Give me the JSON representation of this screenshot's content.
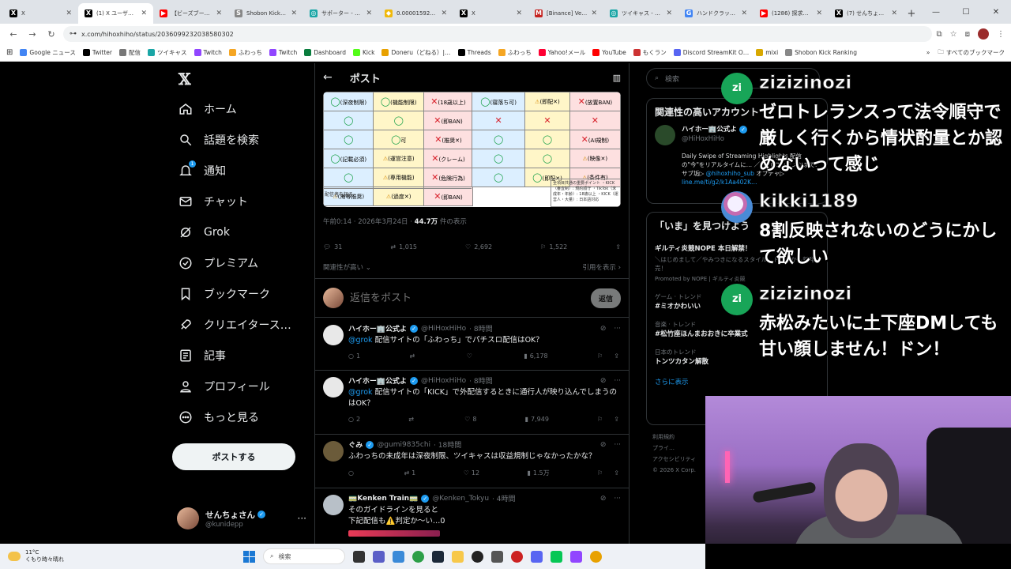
{
  "browser": {
    "tabs": [
      {
        "title": "X",
        "fav": "X",
        "color": "#000000"
      },
      {
        "title": "(1) X ユーザー: 「…",
        "fav": "X",
        "color": "#000000",
        "active": true
      },
      {
        "title": "【ビーズブーリ…",
        "fav": "▶",
        "color": "#ff0000"
      },
      {
        "title": "Shobon Kick…",
        "fav": "S",
        "color": "#888888"
      },
      {
        "title": "サポーター - せ…",
        "fav": "◎",
        "color": "#1aa6a6"
      },
      {
        "title": "0.00001592…",
        "fav": "◆",
        "color": "#f0b90b"
      },
      {
        "title": "X",
        "fav": "X",
        "color": "#000000"
      },
      {
        "title": "[Binance] Ve…",
        "fav": "M",
        "color": "#c5221f"
      },
      {
        "title": "ツイキャス - せ…",
        "fav": "◎",
        "color": "#1aa6a6"
      },
      {
        "title": "ハンドクラップ…",
        "fav": "G",
        "color": "#4285f4"
      },
      {
        "title": "(1286) 探求…",
        "fav": "▶",
        "color": "#ff0000"
      },
      {
        "title": "(7) せんちょさ…",
        "fav": "X",
        "color": "#000000"
      }
    ],
    "new_tab": "+",
    "url": "x.com/hihoxhiho/status/2036099232038580302",
    "bookmarks": [
      {
        "label": "Google ニュース",
        "color": "#4285f4"
      },
      {
        "label": "Twitter",
        "color": "#000000"
      },
      {
        "label": "配信",
        "color": "#777777"
      },
      {
        "label": "ツイキャス",
        "color": "#1aa6a6"
      },
      {
        "label": "Twitch",
        "color": "#9146ff"
      },
      {
        "label": "ふわっち",
        "color": "#f5a623"
      },
      {
        "label": "Twitch",
        "color": "#9146ff"
      },
      {
        "label": "Dashboard",
        "color": "#0a7d3e"
      },
      {
        "label": "Kick",
        "color": "#53fc18"
      },
      {
        "label": "Doneru（どねる）|…",
        "color": "#e8a100"
      },
      {
        "label": "Threads",
        "color": "#000000"
      },
      {
        "label": "ふわっち",
        "color": "#f5a623"
      },
      {
        "label": "Yahoo!メール",
        "color": "#ff0033"
      },
      {
        "label": "YouTube",
        "color": "#ff0000"
      },
      {
        "label": "もくラン",
        "color": "#cc3333"
      },
      {
        "label": "Discord StreamKit O…",
        "color": "#5865f2"
      },
      {
        "label": "mixi",
        "color": "#d8a800"
      },
      {
        "label": "Shobon Kick Ranking",
        "color": "#888888"
      }
    ],
    "all_bookmarks": "すべてのブックマーク"
  },
  "nav": {
    "items": [
      {
        "label": "ホーム",
        "icon": "home-icon"
      },
      {
        "label": "話題を検索",
        "icon": "search-icon"
      },
      {
        "label": "通知",
        "icon": "bell-icon",
        "badge": "1"
      },
      {
        "label": "チャット",
        "icon": "mail-icon"
      },
      {
        "label": "Grok",
        "icon": "grok-icon"
      },
      {
        "label": "プレミアム",
        "icon": "premium-icon"
      },
      {
        "label": "ブックマーク",
        "icon": "bookmark-icon"
      },
      {
        "label": "クリエイタース…",
        "icon": "rocket-icon"
      },
      {
        "label": "記事",
        "icon": "article-icon"
      },
      {
        "label": "プロフィール",
        "icon": "profile-icon"
      },
      {
        "label": "もっと見る",
        "icon": "more-icon"
      }
    ],
    "post_button": "ポストする",
    "account": {
      "name": "せんちょさん",
      "handle": "@kunidepp"
    }
  },
  "main": {
    "title": "ポスト",
    "image_table": {
      "left_rows": [
        [
          "(深夜制限)",
          "(機能制限)",
          "(18歳以上)"
        ],
        [
          "",
          "",
          "(即BAN)"
        ],
        [
          "",
          "可",
          "(推奨✕)"
        ],
        [
          "(記載必須)",
          "(運営注意)",
          "(クレーム)"
        ],
        [
          "",
          "(専用機能)",
          "(危険行為)"
        ],
        [
          "(海等推奨)",
          "(過度✕)",
          "(即BAN)"
        ]
      ],
      "right_rows": [
        [
          "(寝落ち可)",
          "(即配✕)",
          "(放置BAN)"
        ],
        [
          "",
          "",
          ""
        ],
        [
          "",
          "",
          "(AI規制)"
        ],
        [
          "",
          "",
          "(映像✕)"
        ],
        [
          "",
          "(即配✕)",
          "(条件有)"
        ]
      ],
      "note_left": "配信者を知る",
      "note_right": "全項目共通の重要ポイント ・KICK（審査制）: 規約順守 ・TikTok（未成年・年齢）: 18歳以上 ・KICK（運営人・大量）: 日本語対応"
    },
    "timestamp": "午前0:14 · 2026年3月24日 · ",
    "views_count": "44.7万",
    "views_label": " 件の表示",
    "stats": {
      "replies": "31",
      "reposts": "1,015",
      "likes": "2,692",
      "bookmarks": "1,522"
    },
    "related_label": "関連性が高い",
    "quotes_label": "引用を表示",
    "reply_placeholder": "返信をポスト",
    "reply_button": "返信",
    "tweets": [
      {
        "name": "ハイホー🏢公式よ",
        "handle": "@HiHoxHiHo",
        "time": "· 8時間",
        "mention": "@grok",
        "text": " 配信サイトの「ふわっち」でパチスロ配信はOK？",
        "replies": "1",
        "reposts": "",
        "likes": "",
        "views": "6,178"
      },
      {
        "name": "ハイホー🏢公式よ",
        "handle": "@HiHoxHiHo",
        "time": "· 8時間",
        "mention": "@grok",
        "text": " 配信サイトの「KICK」で外配信するときに通行人が映り込んでしまうのはOK？",
        "replies": "2",
        "reposts": "",
        "likes": "8",
        "views": "7,949"
      },
      {
        "name": "ぐみ",
        "handle": "@gumi9835chi",
        "time": "· 18時間",
        "mention": "",
        "text": "ふわっちの未成年は深夜制限、ツイキャスは収益規制じゃなかったかな？",
        "replies": "",
        "reposts": "1",
        "likes": "12",
        "views": "1.5万"
      },
      {
        "name": "🚃Kenken Train🚃",
        "handle": "@Kenken_Tokyu",
        "time": "· 4時間",
        "mention": "",
        "text": "そのガイドラインを見ると\n下記配信も⚠️判定か〜い…0",
        "replies": "",
        "reposts": "",
        "likes": "",
        "views": ""
      }
    ]
  },
  "right": {
    "search_placeholder": "検索",
    "recommend_title": "関連性の高いアカウント",
    "rec_name": "ハイホー🏢公式よ",
    "rec_handle": "@HiHoxHiHo",
    "rec_bio": "Daily Swipe of Streaming Highlights 配信の\"今\"をリアルタイムに… ／ 自作コンテンツまで. サブ垢▷ ",
    "rec_sub": "@hihoxhiho_sub",
    "rec_bio2": " オプチャ▷ ",
    "rec_link": "line.me/ti/g2/k1Aa402K…",
    "trends_title": "「いま」を見つけよう",
    "ad_title": "ギルティ炎競NOPE 本日解禁！",
    "ad_text": "＼はじめまして／やみつきになるスタイル…トリーから新発売！",
    "ad_promo": "Promoted by NOPE | ギルティ炎競",
    "trends": [
      {
        "cat": "ゲーム · トレンド",
        "name": "#ミオかわいい"
      },
      {
        "cat": "音楽 · トレンド",
        "name": "#松竹座ほんまおおきに卒業式"
      },
      {
        "cat": "日本のトレンド",
        "name": "トンツカタン解散"
      }
    ],
    "show_more": "さらに表示",
    "footer": [
      "利用規約",
      "プライ…",
      "アクセシビリティ",
      "© 2026 X Corp."
    ]
  },
  "chat": [
    {
      "initials": "zi",
      "name": "zizizinozi",
      "text": "ゼロトレランスって法令順守で厳しく行くから情状酌量とか認めないって感じ"
    },
    {
      "initials": "",
      "name": "kikki1189",
      "text": "8割反映されないのどうにかして欲しい"
    },
    {
      "initials": "zi",
      "name": "zizizinozi",
      "text": "赤松みたいに土下座DMしても甘い顔しません！ドン！"
    }
  ],
  "taskbar": {
    "temp": "11°C",
    "weather": "くもり時々晴れ",
    "search_placeholder": "検索"
  }
}
